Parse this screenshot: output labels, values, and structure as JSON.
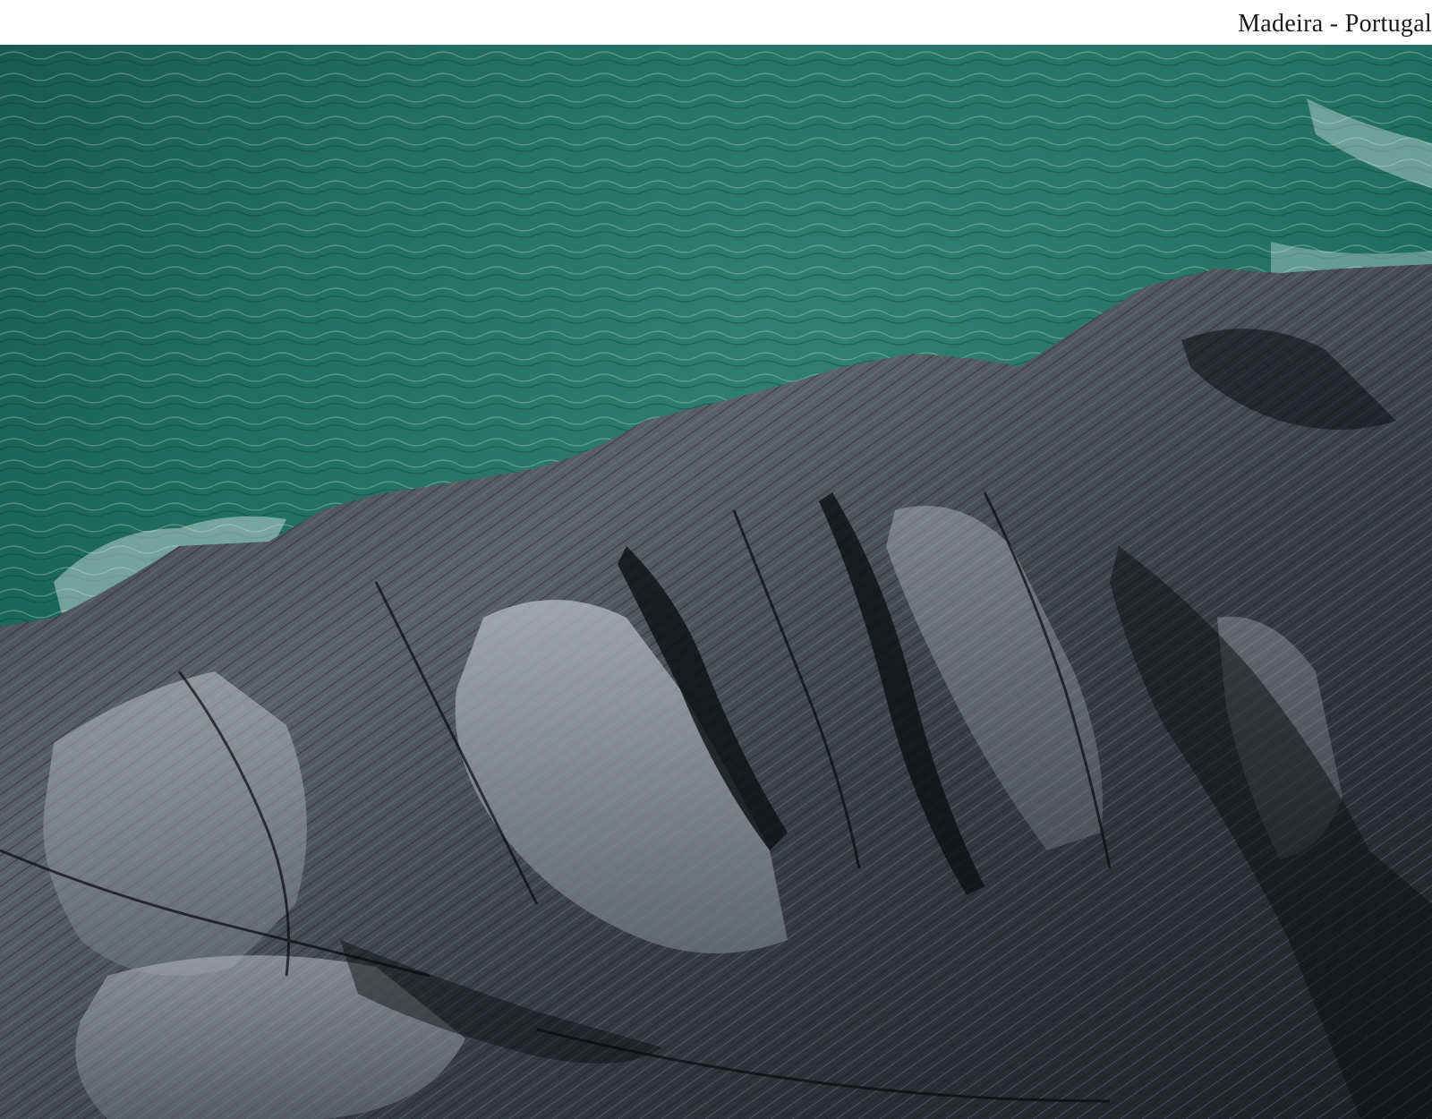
{
  "caption": {
    "text": "Madeira - Portugal"
  },
  "photo": {
    "subject": "aerial view of dark layered coastal rock meeting green ocean water",
    "colors": {
      "sea_deep": "#0f4a44",
      "sea_mid": "#1f6f63",
      "sea_light": "#3f8f80",
      "foam": "#e8f2f0",
      "rock_dark": "#16181b",
      "rock_mid": "#4a4f55",
      "rock_light": "#9aa0a6",
      "rock_highlight": "#c9cdd1"
    }
  }
}
